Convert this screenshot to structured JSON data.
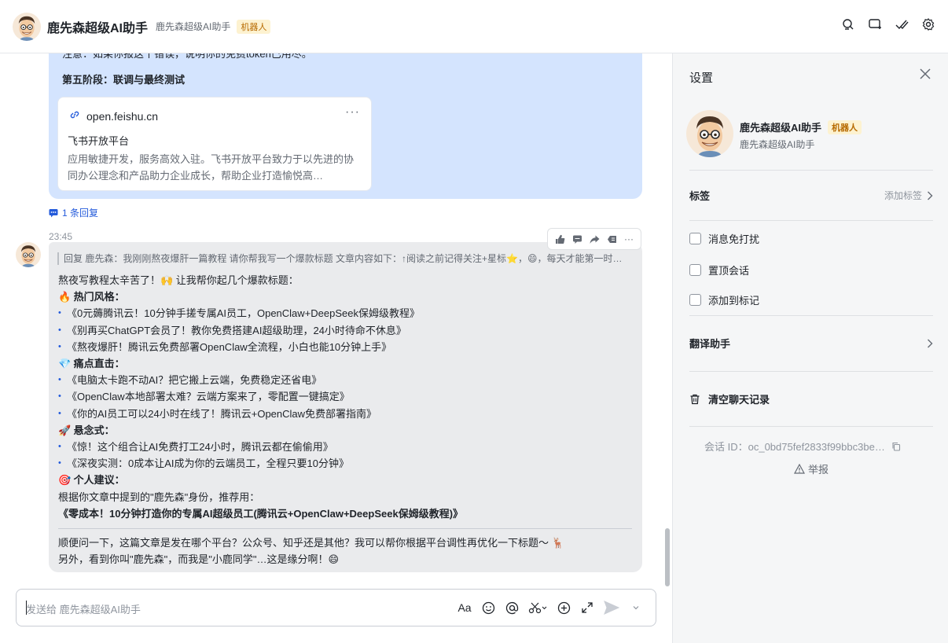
{
  "header": {
    "title": "鹿先森超级AI助手",
    "subtitle": "鹿先森超级AI助手",
    "badge": "机器人"
  },
  "prev_message": {
    "note": "注意：如果你报这个错误，说明你的免费token已用尽。",
    "stage": "第五阶段：联调与最终测试",
    "link_card": {
      "url": "open.feishu.cn",
      "more": "···",
      "title": "飞书开放平台",
      "description": "应用敏捷开发，服务高效入驻。飞书开放平台致力于以先进的协同办公理念和产品助力企业成长，帮助企业打造愉悦高…"
    },
    "reply_count": "1 条回复"
  },
  "message": {
    "time": "23:45",
    "quote": "回复 鹿先森：我刚刚熬夜爆肝一篇教程 请你帮我写一个爆款标题 文章内容如下：↑阅读之前记得关注+星标⭐，😄，每天才能第一时…",
    "intro": "熬夜写教程太辛苦了！🙌 让我帮你起几个爆款标题：",
    "sections": [
      {
        "emoji": "🔥",
        "heading": "热门风格：",
        "items": [
          "《0元薅腾讯云！10分钟手搓专属AI员工，OpenClaw+DeepSeek保姆级教程》",
          "《别再买ChatGPT会员了！教你免费搭建AI超级助理，24小时待命不休息》",
          "《熬夜爆肝！腾讯云免费部署OpenClaw全流程，小白也能10分钟上手》"
        ]
      },
      {
        "emoji": "💎",
        "heading": "痛点直击：",
        "items": [
          "《电脑太卡跑不动AI？把它搬上云端，免费稳定还省电》",
          "《OpenClaw本地部署太难？云端方案来了，零配置一键搞定》",
          "《你的AI员工可以24小时在线了！腾讯云+OpenClaw免费部署指南》"
        ]
      },
      {
        "emoji": "🚀",
        "heading": "悬念式：",
        "items": [
          "《惊！这个组合让AI免费打工24小时，腾讯云都在偷偷用》",
          "《深夜实测：0成本让AI成为你的云端员工，全程只要10分钟》"
        ]
      }
    ],
    "advice": {
      "emoji": "🎯",
      "heading": "个人建议：",
      "text": "根据你文章中提到的\"鹿先森\"身份，推荐用：",
      "recommendation": "《零成本！10分钟打造你的专属AI超级员工(腾讯云+OpenClaw+DeepSeek保姆级教程)》"
    },
    "footer": [
      "顺便问一下，这篇文章是发在哪个平台？公众号、知乎还是其他？我可以帮你根据平台调性再优化一下标题～ 🦌",
      "另外，看到你叫\"鹿先森\"，而我是\"小鹿同学\"…这是缘分啊！😄"
    ]
  },
  "composer": {
    "placeholder": "发送给 鹿先森超级AI助手",
    "font_label": "Aa"
  },
  "settings": {
    "title": "设置",
    "bot_name": "鹿先森超级AI助手",
    "bot_badge": "机器人",
    "bot_sub": "鹿先森超级AI助手",
    "tags_label": "标签",
    "add_tag": "添加标签",
    "checkboxes": [
      "消息免打扰",
      "置顶会话",
      "添加到标记"
    ],
    "translate": "翻译助手",
    "clear": "清空聊天记录",
    "session_id": "会话 ID：oc_0bd75fef2833f99bbc3be…",
    "report": "举报"
  }
}
